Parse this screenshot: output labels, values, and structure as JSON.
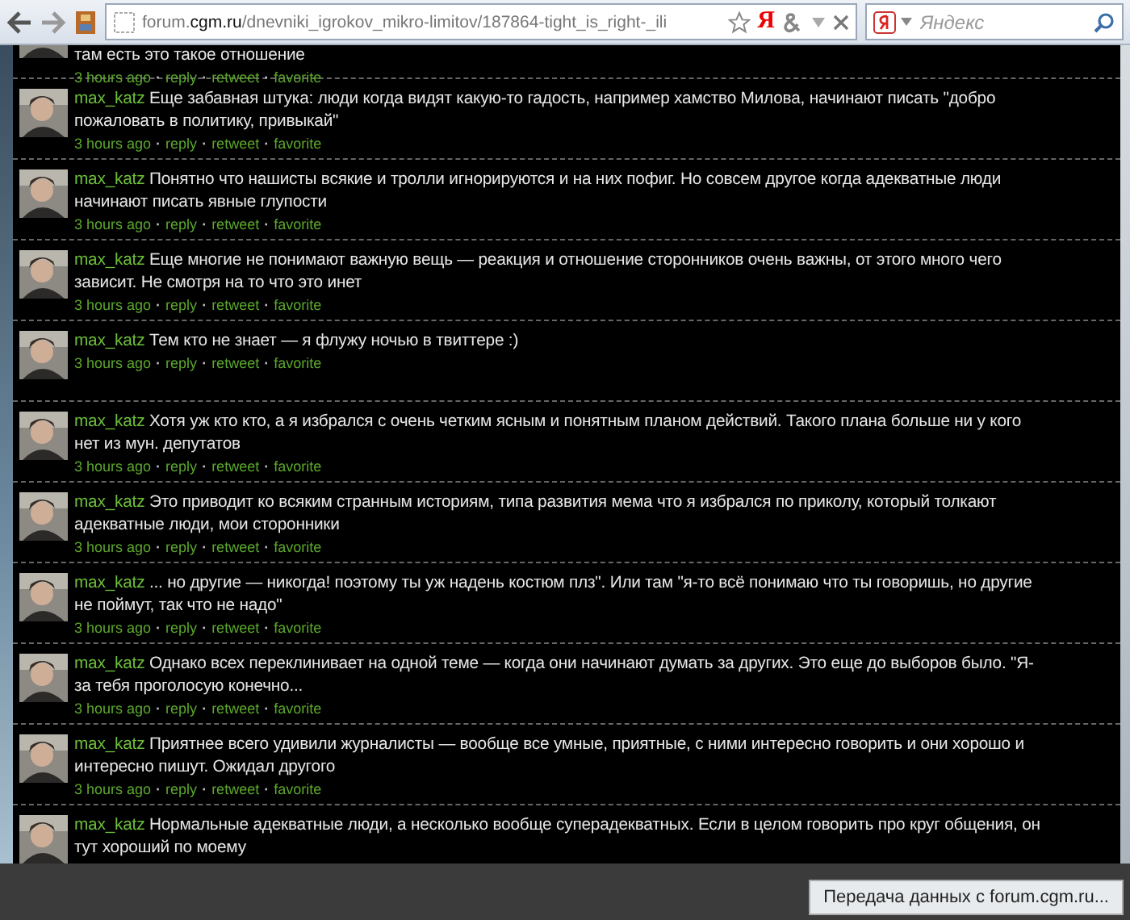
{
  "toolbar": {
    "url": "forum.**cgm.ru**/dnevniki_igrokov_mikro-limitov/187864-tight_is_right-_ili",
    "yandex_letter": "Я",
    "search": {
      "placeholder": "Яндекс"
    }
  },
  "tweets": [
    {
      "kind": "partial",
      "lines": [
        "там есть это такое отношение"
      ],
      "meta": [
        "3 hours ago",
        "reply",
        "retweet",
        "favorite"
      ]
    },
    {
      "kind": "full",
      "user": "max_katz",
      "lines": [
        "Еще забавная штука: люди когда видят какую-то гадость, например хамство Милова, начинают писать \"добро",
        "пожаловать в политику, привыкай\""
      ],
      "meta": [
        "3 hours ago",
        "reply",
        "retweet",
        "favorite"
      ]
    },
    {
      "kind": "full",
      "user": "max_katz",
      "lines": [
        "Понятно что нашисты всякие и тролли игнорируются и на них пофиг. Но совсем другое когда адекватные люди",
        "начинают писать явные глупости"
      ],
      "meta": [
        "3 hours ago",
        "reply",
        "retweet",
        "favorite"
      ]
    },
    {
      "kind": "full",
      "user": "max_katz",
      "lines": [
        "Еще многие не понимают важную вещь — реакция и отношение сторонников очень важны, от этого много чего",
        "зависит. Не смотря на то что это инет"
      ],
      "meta": [
        "3 hours ago",
        "reply",
        "retweet",
        "favorite"
      ]
    },
    {
      "kind": "full",
      "user": "max_katz",
      "lines": [
        "Тем кто не знает — я флужу ночью в твиттере :)"
      ],
      "meta": [
        "3 hours ago",
        "reply",
        "retweet",
        "favorite"
      ]
    },
    {
      "kind": "full",
      "user": "max_katz",
      "lines": [
        "Хотя уж кто кто, а я избрался с очень четким ясным и понятным планом действий. Такого плана больше ни у кого",
        "нет из мун. депутатов"
      ],
      "meta": [
        "3 hours ago",
        "reply",
        "retweet",
        "favorite"
      ]
    },
    {
      "kind": "full",
      "user": "max_katz",
      "lines": [
        "Это приводит ко всяким странным историям, типа развития мема что я избрался по приколу, который толкают",
        "адекватные люди, мои сторонники"
      ],
      "meta": [
        "3 hours ago",
        "reply",
        "retweet",
        "favorite"
      ]
    },
    {
      "kind": "full",
      "user": "max_katz",
      "lines": [
        "... но другие — никогда! поэтому ты уж надень костюм плз\". Или там \"я-то всё понимаю что ты говоришь, но другие",
        "не поймут, так что не надо\""
      ],
      "meta": [
        "3 hours ago",
        "reply",
        "retweet",
        "favorite"
      ]
    },
    {
      "kind": "full",
      "user": "max_katz",
      "lines": [
        "Однако всех переклинивает на одной теме — когда они начинают думать за других. Это еще до выборов было. \"Я-",
        "за тебя проголосую конечно..."
      ],
      "meta": [
        "3 hours ago",
        "reply",
        "retweet",
        "favorite"
      ]
    },
    {
      "kind": "full",
      "user": "max_katz",
      "lines": [
        "Приятнее всего удивили журналисты — вообще все умные, приятные, с ними интересно говорить и они хорошо и",
        "интересно пишут. Ожидал другого"
      ],
      "meta": [
        "3 hours ago",
        "reply",
        "retweet",
        "favorite"
      ]
    },
    {
      "kind": "full",
      "user": "max_katz",
      "lines": [
        "Нормальные адекватные люди, а несколько вообще суперадекватных. Если в целом говорить про круг общения, он",
        "тут хороший по моему"
      ]
    }
  ],
  "meta_separator": "·",
  "status": "Передача данных с forum.cgm.ru..."
}
